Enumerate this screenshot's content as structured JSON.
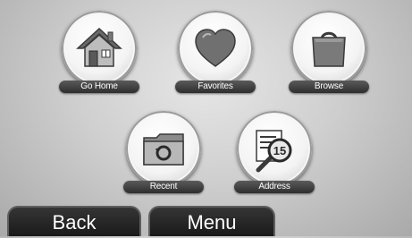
{
  "menu": {
    "items": [
      {
        "label": "Go Home",
        "icon": "house-icon"
      },
      {
        "label": "Favorites",
        "icon": "heart-icon"
      },
      {
        "label": "Browse",
        "icon": "shopping-bag-icon"
      },
      {
        "label": "Recent",
        "icon": "recent-folder-icon"
      },
      {
        "label": "Address",
        "icon": "address-search-icon"
      }
    ],
    "address_badge": "15"
  },
  "softkeys": {
    "back_label": "Back",
    "menu_label": "Menu"
  }
}
